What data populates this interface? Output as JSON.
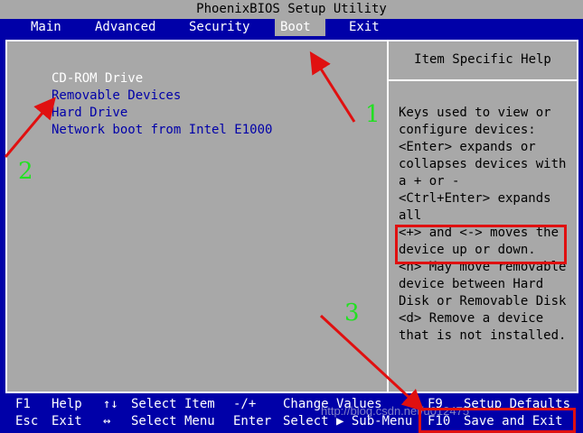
{
  "window": {
    "title": "PhoenixBIOS Setup Utility"
  },
  "menu": [
    {
      "label": "Main",
      "active": false
    },
    {
      "label": "Advanced",
      "active": false
    },
    {
      "label": "Security",
      "active": false
    },
    {
      "label": "Boot",
      "active": true
    },
    {
      "label": "Exit",
      "active": false
    }
  ],
  "boot_list": [
    {
      "label": "CD-ROM Drive",
      "selected": true
    },
    {
      "label": "Removable Devices",
      "selected": false
    },
    {
      "label": "Hard Drive",
      "selected": false
    },
    {
      "label": "Network boot from Intel E1000",
      "selected": false
    }
  ],
  "help": {
    "title": "Item Specific Help",
    "lines": [
      "Keys used to view or",
      "configure devices:",
      "<Enter> expands or",
      "collapses devices with",
      "a + or -",
      "<Ctrl+Enter> expands",
      "all",
      "<+> and <-> moves the",
      "device up or down.",
      "<n> May move removable",
      "device between Hard",
      "Disk or Removable Disk",
      "<d> Remove a device",
      "that is not installed."
    ]
  },
  "footer": {
    "row1": [
      {
        "key": "F1",
        "desc": "Help"
      },
      {
        "key": "↑↓",
        "desc": "Select Item"
      },
      {
        "key": "-/+",
        "desc": "Change Values"
      },
      {
        "key": "F9",
        "desc": "Setup Defaults"
      }
    ],
    "row2": [
      {
        "key": "Esc",
        "desc": "Exit"
      },
      {
        "key": "↔",
        "desc": "Select Menu"
      },
      {
        "key": "Enter",
        "desc": "Select ▶ Sub-Menu"
      },
      {
        "key": "F10",
        "desc": "Save and Exit"
      }
    ]
  },
  "annotations": {
    "labels": [
      "1",
      "2",
      "3"
    ],
    "color": "#e01010",
    "label_color": "#22e022"
  },
  "watermark": "http://blog.csdn.net/u012475",
  "colors": {
    "bios_blue": "#0000a8",
    "bios_gray": "#a8a8a8",
    "selected_text": "#ffffff",
    "item_text": "#0000a8"
  }
}
